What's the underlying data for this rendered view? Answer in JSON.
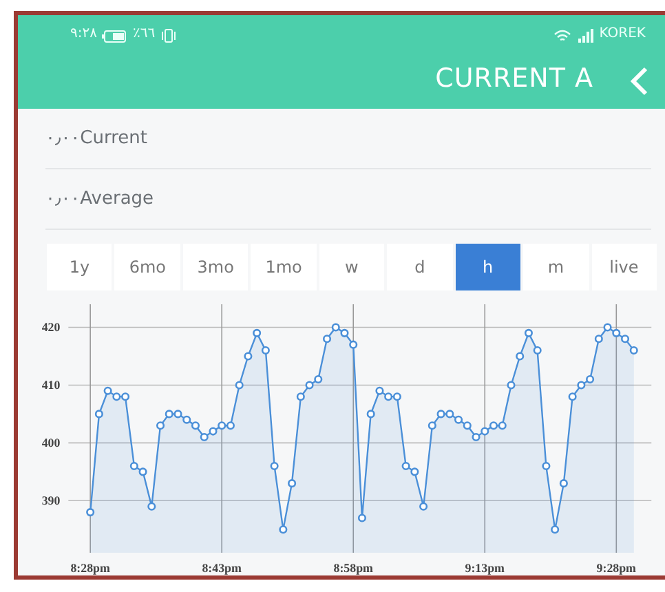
{
  "status_bar": {
    "time": "٩:٢٨",
    "battery": "٪٦٦",
    "carrier": "KOREK"
  },
  "header": {
    "title": "CURRENT A"
  },
  "readings": [
    {
      "label": "٠٫٠٠Current"
    },
    {
      "label": "٠٫٠٠Average"
    }
  ],
  "ranges": [
    {
      "label": "1y",
      "selected": false
    },
    {
      "label": "6mo",
      "selected": false
    },
    {
      "label": "3mo",
      "selected": false
    },
    {
      "label": "1mo",
      "selected": false
    },
    {
      "label": "w",
      "selected": false
    },
    {
      "label": "d",
      "selected": false
    },
    {
      "label": "h",
      "selected": true
    },
    {
      "label": "m",
      "selected": false
    },
    {
      "label": "live",
      "selected": false
    }
  ],
  "chart_data": {
    "type": "area",
    "grid": true,
    "ylim": [
      381,
      424
    ],
    "yticks": [
      390,
      400,
      410,
      420
    ],
    "categories": [
      "8:28pm",
      null,
      null,
      null,
      null,
      null,
      null,
      null,
      null,
      null,
      null,
      null,
      null,
      null,
      null,
      "8:43pm",
      null,
      null,
      null,
      null,
      null,
      null,
      null,
      null,
      null,
      null,
      null,
      null,
      null,
      null,
      "8:58pm",
      null,
      null,
      null,
      null,
      null,
      null,
      null,
      null,
      null,
      null,
      null,
      null,
      null,
      null,
      "9:13pm",
      null,
      null,
      null,
      null,
      null,
      null,
      null,
      null,
      null,
      null,
      null,
      null,
      null,
      null,
      "9:28pm",
      null,
      null
    ],
    "series": [
      {
        "color": "#4a8fd8",
        "marker": "o",
        "values": [
          388,
          405,
          409,
          408,
          408,
          396,
          395,
          389,
          403,
          405,
          405,
          404,
          403,
          401,
          402,
          403,
          403,
          410,
          415,
          419,
          416,
          396,
          385,
          393,
          408,
          410,
          411,
          418,
          420,
          419,
          417,
          387,
          405,
          409,
          408,
          408,
          396,
          395,
          389,
          403,
          405,
          405,
          404,
          403,
          401,
          402,
          403,
          403,
          410,
          415,
          419,
          416,
          396,
          385,
          393,
          408,
          410,
          411,
          418,
          420,
          419,
          418,
          416
        ]
      }
    ]
  }
}
